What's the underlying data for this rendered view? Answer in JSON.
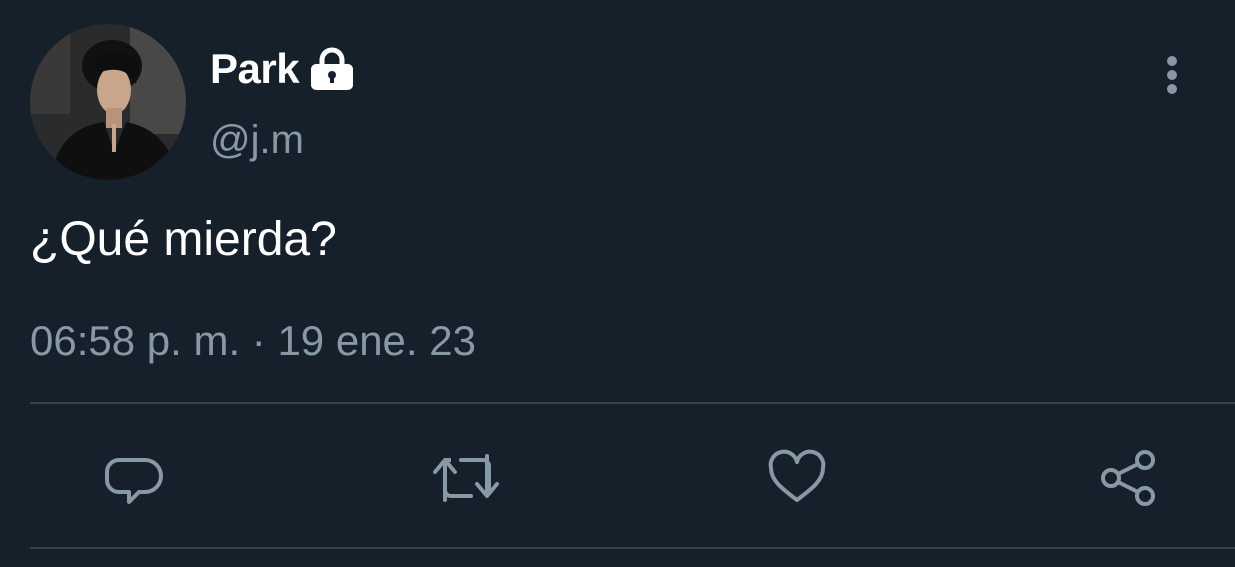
{
  "tweet": {
    "display_name": "Park",
    "handle": "@j.m",
    "text": "¿Qué mierda?",
    "timestamp": "06:58 p. m. · 19 ene. 23",
    "protected": true
  },
  "icons": {
    "lock": "lock-icon",
    "more": "vertical-ellipsis-icon",
    "reply": "speech-bubble-icon",
    "retweet": "retweet-icon",
    "like": "heart-icon",
    "share": "share-icon"
  },
  "colors": {
    "background": "#15202b",
    "primary_text": "#ffffff",
    "secondary_text": "#8899a6",
    "divider": "#38444d"
  }
}
